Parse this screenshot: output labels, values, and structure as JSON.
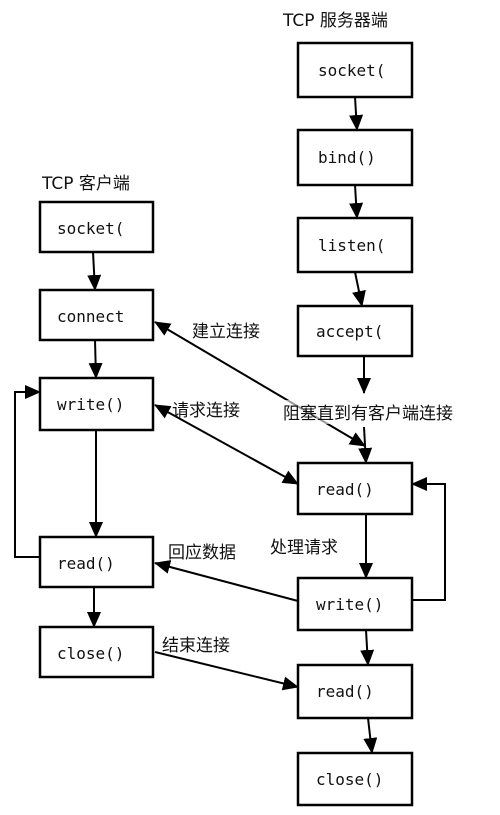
{
  "server": {
    "title": "TCP 服务器端",
    "steps": [
      "socket(",
      "bind()",
      "listen(",
      "accept(",
      "read()",
      "write()",
      "read()",
      "close()"
    ]
  },
  "client": {
    "title": "TCP 客户端",
    "steps": [
      "socket(",
      "connect",
      "write()",
      "read()",
      "close()"
    ]
  },
  "labels": {
    "establish": "建立连接",
    "request": "请求连接",
    "block": "阻塞直到有客户端连接",
    "process": "处理请求",
    "response": "回应数据",
    "end": "结束连接"
  }
}
